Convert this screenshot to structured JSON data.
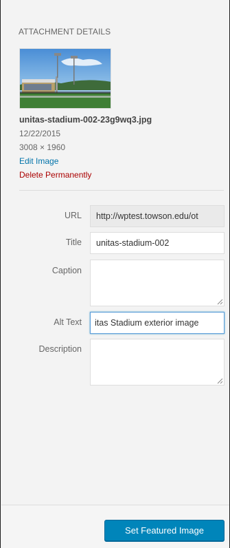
{
  "panel": {
    "heading": "ATTACHMENT DETAILS",
    "file": {
      "filename": "unitas-stadium-002-23g9wq3.jpg",
      "date": "12/22/2015",
      "dimensions": "3008 × 1960",
      "edit_link": "Edit Image",
      "delete_link": "Delete Permanently"
    },
    "fields": {
      "url": {
        "label": "URL",
        "value": "http://wptest.towson.edu/ot"
      },
      "title": {
        "label": "Title",
        "value": "unitas-stadium-002"
      },
      "caption": {
        "label": "Caption",
        "value": ""
      },
      "alt_text": {
        "label": "Alt Text",
        "value": "itas Stadium exterior image"
      },
      "description": {
        "label": "Description",
        "value": ""
      }
    }
  },
  "footer": {
    "button_label": "Set Featured Image"
  },
  "colors": {
    "link": "#0073aa",
    "delete": "#a00000",
    "primary_button": "#0085ba",
    "focus_border": "#5b9dd9"
  },
  "icons": {
    "resize_grip": "resize-grip-icon"
  }
}
